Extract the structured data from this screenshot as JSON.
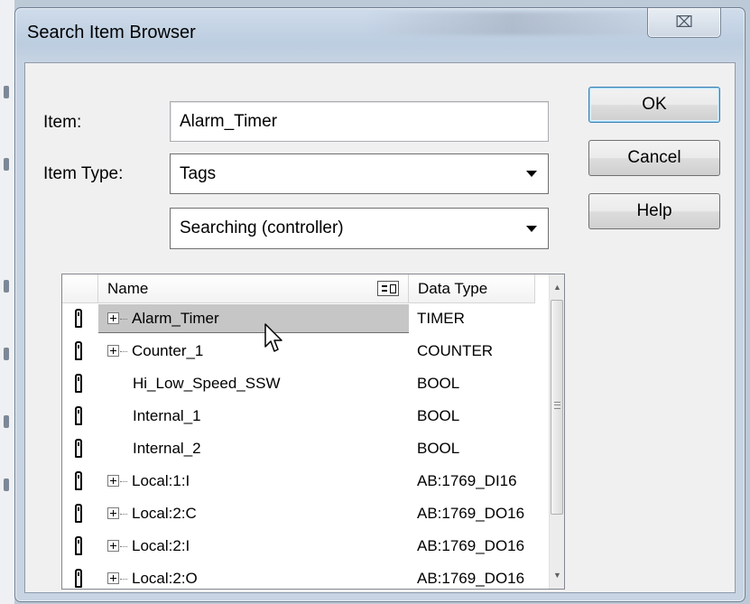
{
  "dialog": {
    "title": "Search Item Browser",
    "close_symbol": "⌧"
  },
  "form": {
    "item_label": "Item:",
    "item_value": "Alarm_Timer",
    "item_type_label": "Item Type:",
    "item_type_value": "Tags",
    "scope_value": "Searching (controller)"
  },
  "buttons": {
    "ok": "OK",
    "cancel": "Cancel",
    "help": "Help"
  },
  "grid": {
    "columns": [
      "Name",
      "Data Type"
    ],
    "rows": [
      {
        "name": "Alarm_Timer",
        "type": "TIMER",
        "expandable": true,
        "selected": true
      },
      {
        "name": "Counter_1",
        "type": "COUNTER",
        "expandable": true
      },
      {
        "name": "Hi_Low_Speed_SSW",
        "type": "BOOL",
        "expandable": false
      },
      {
        "name": "Internal_1",
        "type": "BOOL",
        "expandable": false
      },
      {
        "name": "Internal_2",
        "type": "BOOL",
        "expandable": false
      },
      {
        "name": "Local:1:I",
        "type": "AB:1769_DI16",
        "expandable": true
      },
      {
        "name": "Local:2:C",
        "type": "AB:1769_DO16",
        "expandable": true
      },
      {
        "name": "Local:2:I",
        "type": "AB:1769_DO16",
        "expandable": true
      },
      {
        "name": "Local:2:O",
        "type": "AB:1769_DO16",
        "expandable": true
      }
    ]
  },
  "icons": {
    "tag": "tag-icon",
    "expand": "plus-expander-icon",
    "filter": "filter-column-icon",
    "cursor": "mouse-pointer-icon"
  }
}
